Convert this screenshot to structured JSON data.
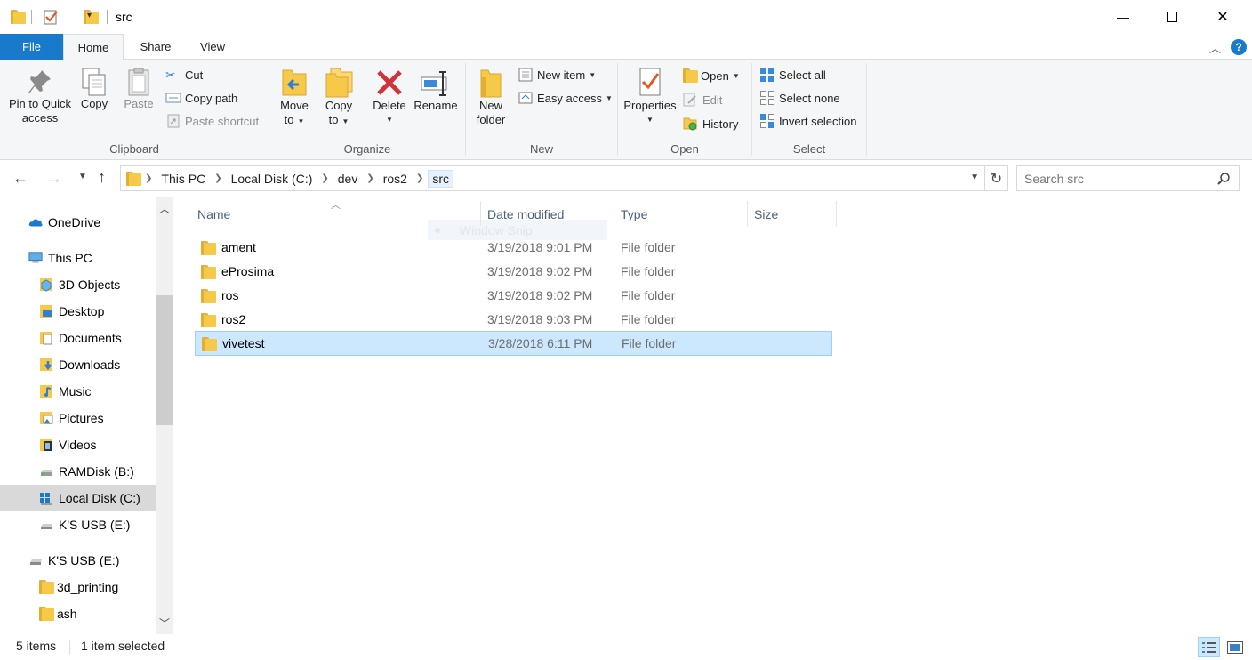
{
  "window": {
    "title": "src",
    "minimize_glyph": "—",
    "maximize_glyph": "☐",
    "close_glyph": "✕"
  },
  "ribbon_tabs": [
    "File",
    "Home",
    "Share",
    "View"
  ],
  "ribbon": {
    "clipboard": {
      "label": "Clipboard",
      "pin_line1": "Pin to Quick",
      "pin_line2": "access",
      "copy": "Copy",
      "paste": "Paste",
      "cut": "Cut",
      "copy_path": "Copy path",
      "paste_shortcut": "Paste shortcut"
    },
    "organize": {
      "label": "Organize",
      "move_line1": "Move",
      "move_line2": "to",
      "copy_line1": "Copy",
      "copy_line2": "to",
      "delete": "Delete",
      "rename": "Rename"
    },
    "new": {
      "label": "New",
      "new_folder_line1": "New",
      "new_folder_line2": "folder",
      "new_item": "New item",
      "easy_access": "Easy access"
    },
    "open": {
      "label": "Open",
      "properties": "Properties",
      "open": "Open",
      "edit": "Edit",
      "history": "History"
    },
    "select": {
      "label": "Select",
      "select_all": "Select all",
      "select_none": "Select none",
      "invert_selection": "Invert selection"
    }
  },
  "address": {
    "crumbs": [
      "This PC",
      "Local Disk (C:)",
      "dev",
      "ros2",
      "src"
    ],
    "search_placeholder": "Search src"
  },
  "nav_pane": {
    "items": [
      {
        "label": "OneDrive",
        "icon": "onedrive-icon"
      },
      {
        "label": "This PC",
        "icon": "computer-icon"
      },
      {
        "label": "3D Objects",
        "icon": "3d-objects-icon"
      },
      {
        "label": "Desktop",
        "icon": "desktop-icon"
      },
      {
        "label": "Documents",
        "icon": "documents-icon"
      },
      {
        "label": "Downloads",
        "icon": "downloads-icon"
      },
      {
        "label": "Music",
        "icon": "music-icon"
      },
      {
        "label": "Pictures",
        "icon": "pictures-icon"
      },
      {
        "label": "Videos",
        "icon": "videos-icon"
      },
      {
        "label": "RAMDisk (B:)",
        "icon": "drive-icon"
      },
      {
        "label": "Local Disk (C:)",
        "icon": "windows-drive-icon"
      },
      {
        "label": "K'S USB (E:)",
        "icon": "usb-drive-icon"
      },
      {
        "label": "K'S USB (E:)",
        "icon": "usb-drive-icon"
      },
      {
        "label": "3d_printing",
        "icon": "folder-icon"
      },
      {
        "label": "ash",
        "icon": "folder-icon"
      }
    ]
  },
  "file_list": {
    "columns": [
      "Name",
      "Date modified",
      "Type",
      "Size"
    ],
    "rows": [
      {
        "name": "ament",
        "date": "3/19/2018 9:01 PM",
        "type": "File folder",
        "selected": false
      },
      {
        "name": "eProsima",
        "date": "3/19/2018 9:02 PM",
        "type": "File folder",
        "selected": false
      },
      {
        "name": "ros",
        "date": "3/19/2018 9:02 PM",
        "type": "File folder",
        "selected": false
      },
      {
        "name": "ros2",
        "date": "3/19/2018 9:03 PM",
        "type": "File folder",
        "selected": false
      },
      {
        "name": "vivetest",
        "date": "3/28/2018 6:11 PM",
        "type": "File folder",
        "selected": true
      }
    ],
    "ghost_overlay": "Window Snip"
  },
  "status": {
    "items_count": "5 items",
    "selection": "1 item selected"
  },
  "colors": {
    "file_tab": "#1979ca",
    "selection_bg": "#cce8ff",
    "selection_border": "#99d1ff",
    "folder": "#f7c948",
    "delete_red": "#d13438"
  }
}
